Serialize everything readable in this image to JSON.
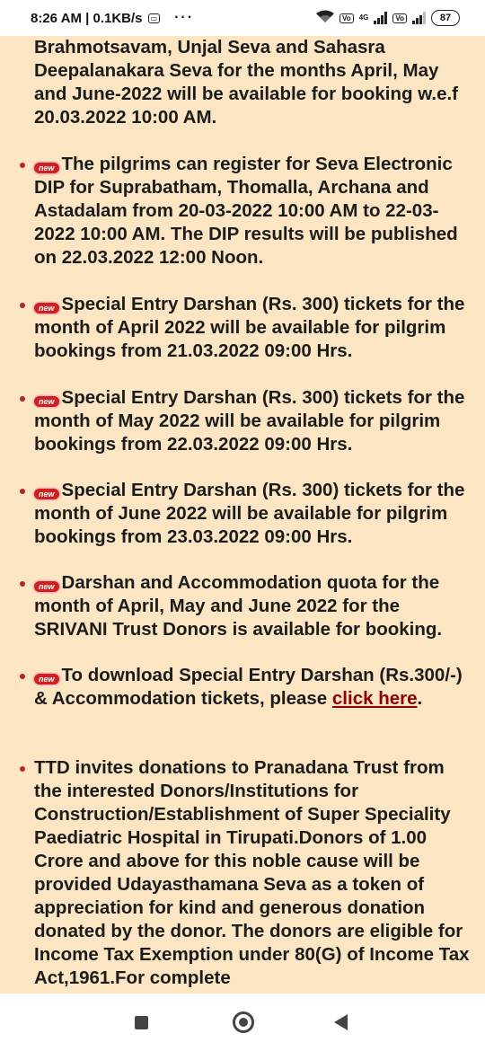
{
  "status_bar": {
    "time_speed": "8:26 AM | 0.1KB/s",
    "overflow": "···",
    "network_label": "4G",
    "volte_label": "Vo",
    "battery": "87"
  },
  "items": [
    {
      "new": false,
      "bullet": false,
      "text": "Brahmotsavam, Unjal Seva and Sahasra Deepalanakara Seva for the months April, May and June-2022 will be available for booking w.e.f 20.03.2022 10:00 AM."
    },
    {
      "new": true,
      "bullet": true,
      "text": "The pilgrims can register for Seva Electronic DIP for Suprabatham, Thomalla, Archana and Astadalam from 20-03-2022 10:00 AM to 22-03-2022 10:00 AM. The DIP results will be published on 22.03.2022 12:00 Noon."
    },
    {
      "new": true,
      "bullet": true,
      "text": "Special Entry Darshan (Rs. 300) tickets for the month of April 2022 will be available for pilgrim bookings from 21.03.2022 09:00 Hrs."
    },
    {
      "new": true,
      "bullet": true,
      "text": "Special Entry Darshan (Rs. 300) tickets for the month of May 2022 will be available for pilgrim bookings from 22.03.2022 09:00 Hrs."
    },
    {
      "new": true,
      "bullet": true,
      "text": "Special Entry Darshan (Rs. 300) tickets for the month of June 2022 will be available for pilgrim bookings from 23.03.2022 09:00 Hrs."
    },
    {
      "new": true,
      "bullet": true,
      "text": "Darshan and Accommodation quota for the month of April, May and June 2022 for the SRIVANI Trust Donors is available for booking."
    },
    {
      "new": true,
      "bullet": true,
      "text": "To download Special Entry Darshan (Rs.300/-) & Accommodation tickets, please",
      "link": "click here",
      "after_link": "."
    },
    {
      "new": false,
      "bullet": true,
      "text": "TTD invites donations to Pranadana Trust from the interested Donors/Institutions for Construction/Establishment of Super Speciality Paediatric Hospital in Tirupati.Donors of 1.00 Crore and above for this noble cause will be provided Udayasthamana Seva as a token of appreciation for kind and generous donation donated by the donor. The donors are eligible for Income Tax Exemption under 80(G) of Income Tax Act,1961.For complete"
    }
  ],
  "badge_label": "new",
  "colors": {
    "background": "#fbe5c3",
    "bullet": "#b3261e",
    "badge": "#cf1f1f",
    "link": "#8b0000"
  },
  "nav": {
    "recents_icon": "square-icon",
    "home_icon": "circle-icon",
    "back_icon": "triangle-back-icon"
  }
}
